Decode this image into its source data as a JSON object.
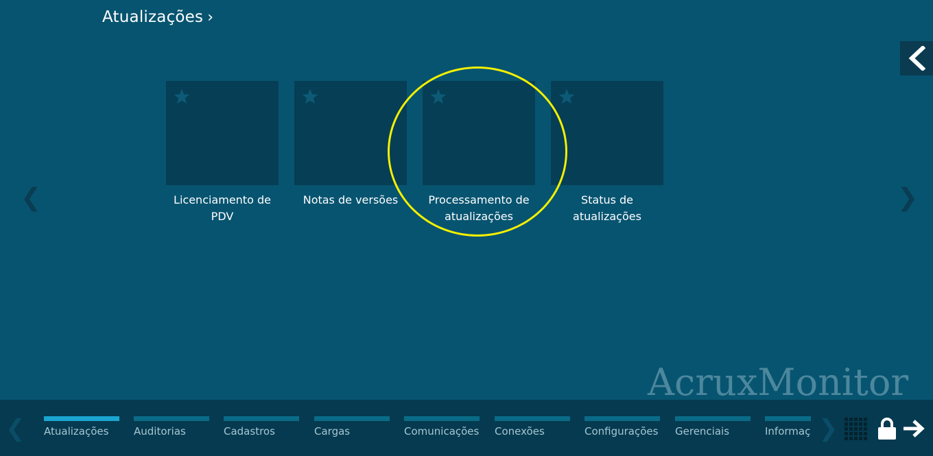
{
  "header": {
    "title": "Atualizações",
    "title_chevron": "›"
  },
  "nav": {
    "back_icon": "chevron-left-icon",
    "prev_page": "❮",
    "next_page": "❯"
  },
  "tiles": [
    {
      "label_line1": "Licenciamento de",
      "label_line2": "PDV",
      "icon": "star-icon"
    },
    {
      "label_line1": "Notas de versões",
      "label_line2": "",
      "icon": "star-icon"
    },
    {
      "label_line1": "Processamento de",
      "label_line2": "atualizações",
      "icon": "star-icon"
    },
    {
      "label_line1": "Status de",
      "label_line2": "atualizações",
      "icon": "star-icon"
    }
  ],
  "brand": {
    "text": "AcruxMonitor"
  },
  "taskbar": {
    "prev": "❮",
    "next": "❯",
    "tabs": [
      {
        "label": "Atualizações",
        "active": true
      },
      {
        "label": "Auditorias",
        "active": false
      },
      {
        "label": "Cadastros",
        "active": false
      },
      {
        "label": "Cargas",
        "active": false
      },
      {
        "label": "Comunicações",
        "active": false
      },
      {
        "label": "Conexões",
        "active": false
      },
      {
        "label": "Configurações",
        "active": false
      },
      {
        "label": "Gerenciais",
        "active": false
      },
      {
        "label": "Informações",
        "active": false
      }
    ],
    "icons": [
      "grid-icon",
      "lock-icon",
      "arrow-right-icon"
    ]
  },
  "colors": {
    "background": "#075470",
    "tile": "#063e56",
    "taskbar": "#053a50",
    "active_tab": "#1aa5d0",
    "highlight": "#f4f000",
    "brand": "#4d879d"
  }
}
